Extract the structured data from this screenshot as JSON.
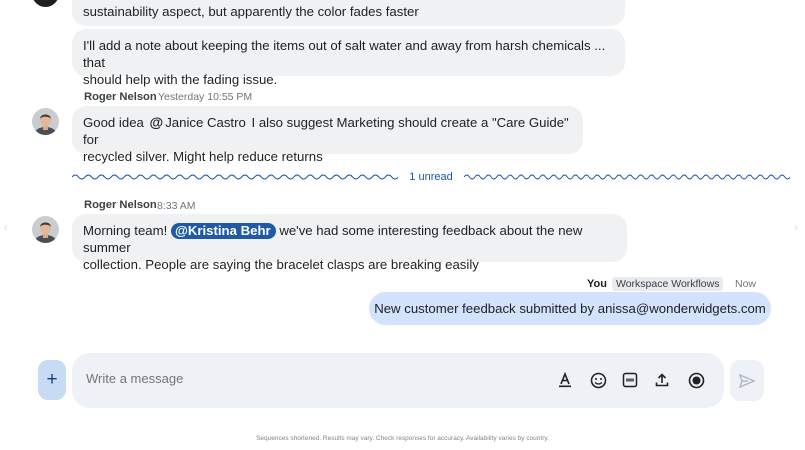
{
  "messages": [
    {
      "id": "prev",
      "text_line1": "sustainability aspect, but apparently the color fades faster",
      "followup_line1": "I'll add a note about keeping the items out of salt water and away from harsh chemicals ... that",
      "followup_line2": "should help with the fading issue."
    },
    {
      "id": "roger1",
      "sender": "Roger Nelson",
      "time": "Yesterday 10:55 PM",
      "pre": "Good idea",
      "mention": "Janice Castro",
      "post": "I also suggest Marketing should create a \"Care Guide\" for",
      "line2": "recycled silver. Might help reduce returns"
    },
    {
      "id": "roger2",
      "sender": "Roger Nelson",
      "time": "8:33 AM",
      "pre": "Morning team!",
      "mention": "Kristina Behr",
      "post": "we've had some interesting feedback about the new summer",
      "line2": "collection. People are saying the bracelet clasps are breaking easily"
    }
  ],
  "unread": {
    "label": "1 unread",
    "color": "#1a56a8"
  },
  "self_message": {
    "sender": "You",
    "app": "Workspace Workflows",
    "time": "Now",
    "text": "New customer feedback submitted by anissa@wonderwidgets.com"
  },
  "composer": {
    "add_label": "+",
    "placeholder": "Write a message",
    "tools": [
      "format-text-icon",
      "emoji-icon",
      "gif-icon",
      "upload-icon",
      "record-icon"
    ],
    "send_icon": "send-icon"
  },
  "footer": {
    "disclaimer": "Sequences shortened. Results may vary. Check responses for accuracy. Availability varies by country."
  }
}
